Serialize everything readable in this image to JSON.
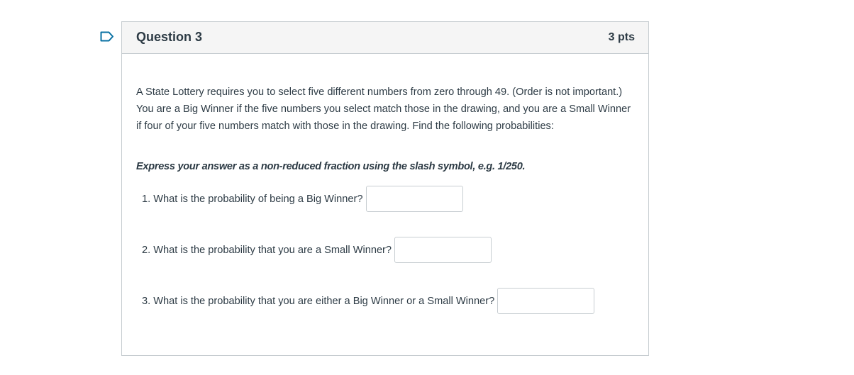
{
  "question": {
    "title": "Question 3",
    "points": "3 pts",
    "text": "A State Lottery requires you to select five different numbers from zero through 49. (Order is not important.) You are a Big Winner if the five numbers you select match those in the drawing, and you are a Small Winner if four of your five numbers match with those in the drawing.  Find the following probabilities:",
    "instruction": "Express your answer as a non-reduced fraction using the slash symbol, e.g. 1/250.",
    "subquestions": [
      {
        "label": "1. What is the probability of being a Big Winner?",
        "value": ""
      },
      {
        "label": "2. What is the probability that you are a Small Winner?",
        "value": ""
      },
      {
        "label": "3. What is the probability that you are either a Big Winner or a Small Winner?",
        "value": ""
      }
    ]
  },
  "colors": {
    "accent": "#0770a3",
    "text": "#2d3b45",
    "border": "#c7cdd1",
    "header_bg": "#f5f5f5"
  },
  "icons": {
    "flag": "flag-outline-icon"
  }
}
